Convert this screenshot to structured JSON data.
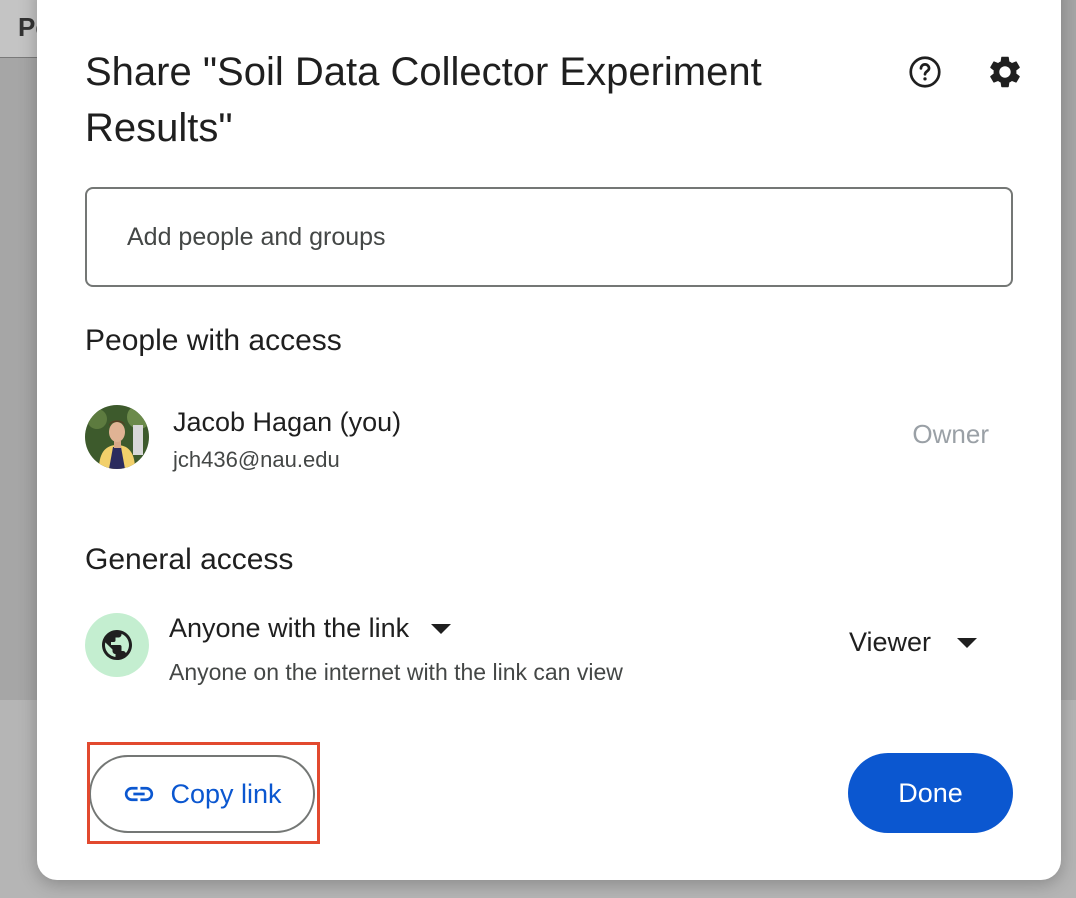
{
  "background": {
    "tab_text": "Pe"
  },
  "dialog": {
    "title": "Share \"Soil Data Collector Experiment Results\"",
    "help_icon": "help-circle-icon",
    "settings_icon": "gear-icon"
  },
  "add_people": {
    "placeholder": "Add people and groups",
    "value": ""
  },
  "people_section": {
    "title": "People with access",
    "people": [
      {
        "name": "Jacob Hagan (you)",
        "email": "jch436@nau.edu",
        "role": "Owner"
      }
    ]
  },
  "general_access": {
    "title": "General access",
    "link_setting": "Anyone with the link",
    "description": "Anyone on the internet with the link can view",
    "role": "Viewer",
    "icon": "globe-icon"
  },
  "footer": {
    "copy_link_label": "Copy link",
    "done_label": "Done"
  },
  "colors": {
    "accent": "#0b57d0",
    "highlight": "#e2492f",
    "globe_bg": "#c4eed0"
  }
}
